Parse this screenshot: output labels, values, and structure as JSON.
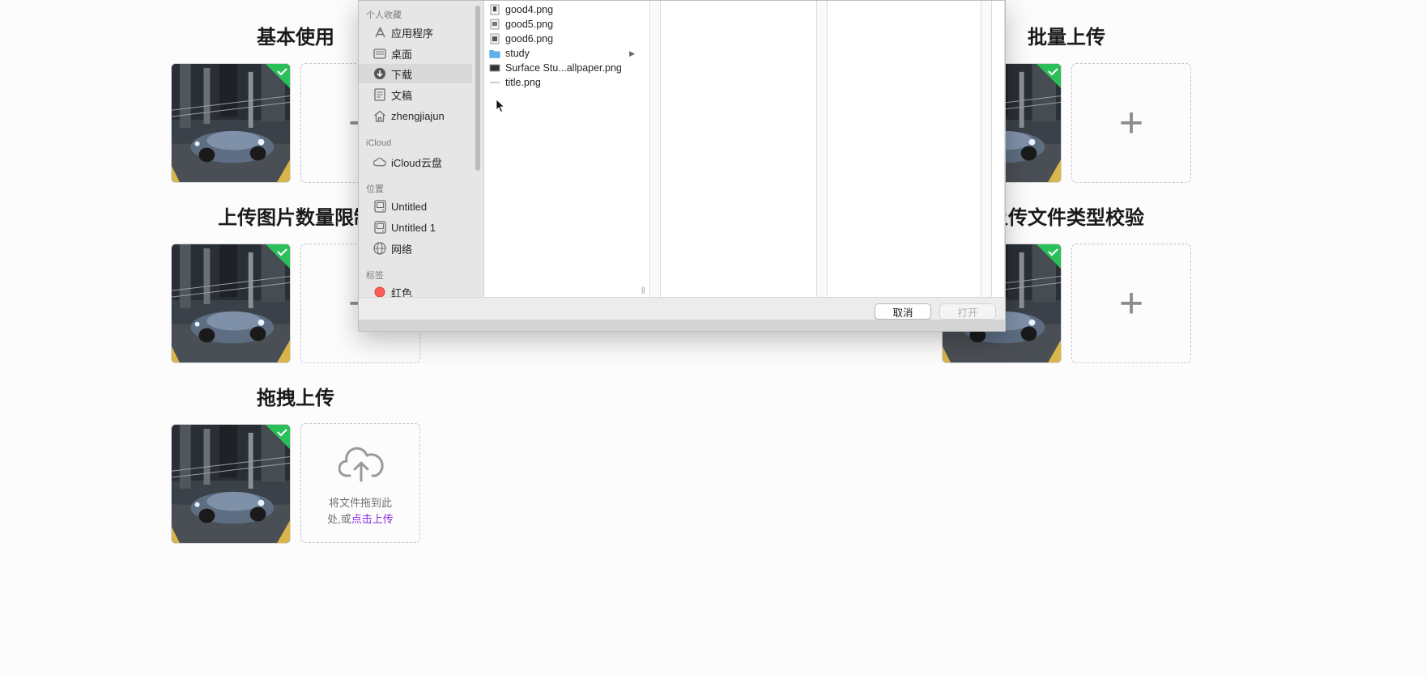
{
  "sections": {
    "basic": "基本使用",
    "batch": "批量上传",
    "limit": "上传图片数量限制",
    "type_check": "上传文件类型校验",
    "drag": "拖拽上传"
  },
  "drag_upload": {
    "hint_line1": "将文件拖到此",
    "hint_line2_prefix": "处,或",
    "hint_link": "点击上传"
  },
  "add_button": {
    "symbol": "+"
  },
  "dialog": {
    "sidebar": {
      "favorites_header": "个人收藏",
      "favorites": [
        {
          "label": "应用程序",
          "icon": "applications-icon"
        },
        {
          "label": "桌面",
          "icon": "desktop-icon"
        },
        {
          "label": "下载",
          "icon": "downloads-icon",
          "selected": true
        },
        {
          "label": "文稿",
          "icon": "documents-icon"
        },
        {
          "label": "zhengjiajun",
          "icon": "home-icon"
        }
      ],
      "icloud_header": "iCloud",
      "icloud": [
        {
          "label": "iCloud云盘",
          "icon": "cloud-icon"
        }
      ],
      "locations_header": "位置",
      "locations": [
        {
          "label": "Untitled",
          "icon": "disk-icon"
        },
        {
          "label": "Untitled 1",
          "icon": "disk-icon"
        },
        {
          "label": "网络",
          "icon": "network-icon"
        }
      ],
      "tags_header": "标签",
      "tags": [
        {
          "label": "红色",
          "color": "#ff5c57"
        }
      ]
    },
    "files": [
      {
        "name": "good4.png",
        "kind": "image"
      },
      {
        "name": "good5.png",
        "kind": "image"
      },
      {
        "name": "good6.png",
        "kind": "image"
      },
      {
        "name": "study",
        "kind": "folder"
      },
      {
        "name": "Surface Stu...allpaper.png",
        "kind": "image"
      },
      {
        "name": "title.png",
        "kind": "image"
      }
    ],
    "cancel_label": "取消",
    "open_label": "打开"
  },
  "colors": {
    "success": "#2bbf5a",
    "link": "#8a2be2",
    "folder": "#5fb3f2"
  }
}
